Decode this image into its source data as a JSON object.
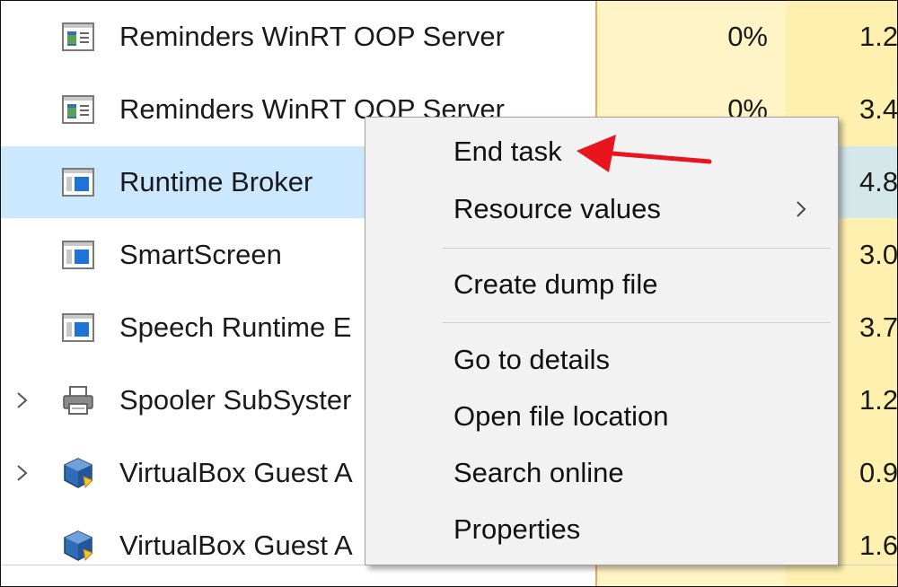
{
  "processes": [
    {
      "name": "Reminders WinRT OOP Server",
      "cpu": "0%",
      "memory": "1.2",
      "icon": "app-window-icon",
      "expandable": false,
      "selected": false
    },
    {
      "name": "Reminders WinRT OOP Server",
      "cpu": "0%",
      "memory": "3.4",
      "icon": "app-window-icon",
      "expandable": false,
      "selected": false
    },
    {
      "name": "Runtime Broker",
      "cpu": "",
      "memory": "4.8",
      "icon": "service-window-icon",
      "expandable": false,
      "selected": true
    },
    {
      "name": "SmartScreen",
      "cpu": "",
      "memory": "3.0",
      "icon": "service-window-icon",
      "expandable": false,
      "selected": false
    },
    {
      "name": "Speech Runtime E",
      "cpu": "",
      "memory": "3.7",
      "icon": "service-window-icon",
      "expandable": false,
      "selected": false
    },
    {
      "name": "Spooler SubSyster",
      "cpu": "",
      "memory": "1.2",
      "icon": "printer-icon",
      "expandable": true,
      "selected": false
    },
    {
      "name": "VirtualBox Guest A",
      "cpu": "",
      "memory": "0.9",
      "icon": "virtualbox-icon",
      "expandable": true,
      "selected": false
    },
    {
      "name": "VirtualBox Guest A",
      "cpu": "",
      "memory": "1.6",
      "icon": "virtualbox-icon",
      "expandable": false,
      "selected": false
    }
  ],
  "context_menu": {
    "end_task": "End task",
    "resource_values": "Resource values",
    "create_dump_file": "Create dump file",
    "go_to_details": "Go to details",
    "open_file_location": "Open file location",
    "search_online": "Search online",
    "properties": "Properties"
  },
  "colors": {
    "selection": "#cce8ff",
    "cpu_column": "#fff4c6",
    "memory_column": "#fff0b0",
    "column_border": "#f0a85c",
    "menu_background": "#f2f2f2",
    "annotation_arrow": "#e8141e"
  }
}
